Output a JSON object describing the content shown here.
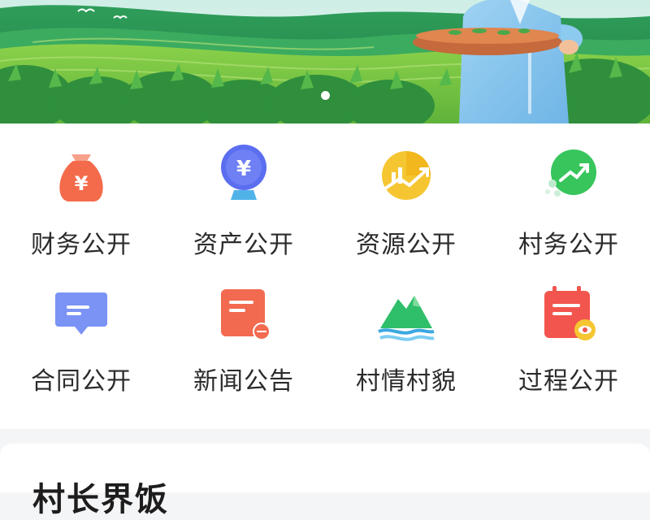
{
  "banner": {
    "alt": "tea garden banner",
    "slides_total": 2,
    "active_slide": 1
  },
  "menu": {
    "row1": [
      {
        "label": "财务公开",
        "icon": "money-bag-icon",
        "color": "#f46b4c"
      },
      {
        "label": "资产公开",
        "icon": "coin-stand-icon",
        "color": "#5b6ef0"
      },
      {
        "label": "资源公开",
        "icon": "growth-chart-icon",
        "color": "#f2b71c"
      },
      {
        "label": "村务公开",
        "icon": "trend-up-icon",
        "color": "#37c55c"
      }
    ],
    "row2": [
      {
        "label": "合同公开",
        "icon": "contract-board-icon",
        "color": "#6f8cf3"
      },
      {
        "label": "新闻公告",
        "icon": "news-icon",
        "color": "#f26a4f"
      },
      {
        "label": "村情村貌",
        "icon": "mountain-icon",
        "color": "#2fbf6a"
      },
      {
        "label": "过程公开",
        "icon": "calendar-eye-icon",
        "color": "#f2554d"
      }
    ]
  },
  "section": {
    "title": "村长界饭"
  }
}
